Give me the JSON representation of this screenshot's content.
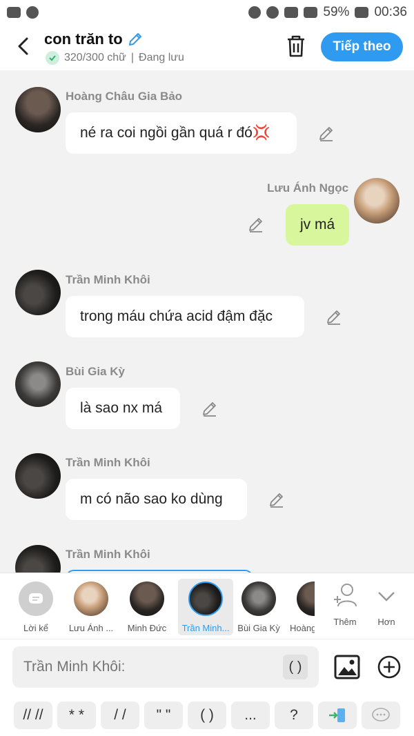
{
  "status_bar": {
    "battery": "59%",
    "time": "00:36"
  },
  "header": {
    "title": "con trăn to",
    "word_count": "320/300 chữ",
    "separator": "|",
    "save_status": "Đang lưu",
    "next_button": "Tiếp theo"
  },
  "messages": [
    {
      "sender": "Hoàng Châu Gia Bảo",
      "text": "né ra coi ngồi gần quá r đó💢"
    },
    {
      "sender": "Lưu Ánh Ngọc",
      "text": "jv má"
    },
    {
      "sender": "Trần Minh Khôi",
      "text": "trong máu chứa acid đậm đặc"
    },
    {
      "sender": "Bùi Gia Kỳ",
      "text": "là sao nx má"
    },
    {
      "sender": "Trần Minh Khôi",
      "text": "m có não sao ko dùng"
    },
    {
      "sender": "Trần Minh Khôi",
      "text": ""
    }
  ],
  "speakers": [
    {
      "label": "Lời kể"
    },
    {
      "label": "Lưu Ánh ..."
    },
    {
      "label": "Minh Đức"
    },
    {
      "label": "Trần Minh..."
    },
    {
      "label": "Bùi Gia Kỳ"
    },
    {
      "label": "Hoàng"
    },
    {
      "label": "Thêm"
    },
    {
      "label": "Hơn"
    }
  ],
  "input": {
    "placeholder": "Trần Minh Khôi:",
    "paren_chip": "( )"
  },
  "symbols": [
    "// //",
    "* *",
    "/ /",
    "\" \"",
    "( )",
    "...",
    "?"
  ],
  "colors": {
    "accent": "#2f9bf0",
    "mine_bubble": "#d8f79c",
    "background": "#f2f2f2"
  }
}
